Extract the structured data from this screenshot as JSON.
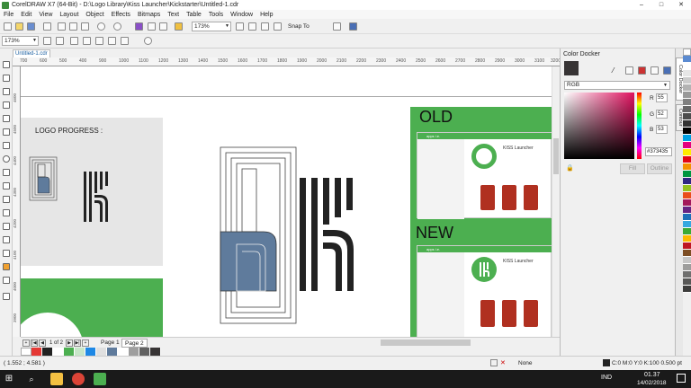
{
  "window": {
    "title": "CorelDRAW X7 (64-Bit) - D:\\Logo Library\\Kiss Launcher\\Kickstarter\\Untitled-1.cdr",
    "minimize": "–",
    "maximize": "□",
    "close": "✕"
  },
  "menu": [
    "File",
    "Edit",
    "View",
    "Layout",
    "Object",
    "Effects",
    "Bitmaps",
    "Text",
    "Table",
    "Tools",
    "Window",
    "Help"
  ],
  "toolbar": {
    "zoom": "173%",
    "snap_to": "Snap To",
    "zoom_left": "173%"
  },
  "document": {
    "tab": "Untitled-1.cdr"
  },
  "ruler": {
    "h_ticks": [
      "700",
      "600",
      "500",
      "400",
      "900",
      "1000",
      "1100",
      "1200",
      "1300",
      "1400",
      "1500",
      "1600",
      "1700",
      "1800",
      "1900",
      "2000",
      "2100",
      "2200",
      "2300",
      "2400",
      "2500",
      "2600",
      "2700",
      "2800",
      "2900",
      "3000",
      "3100",
      "3200"
    ],
    "v_ticks": [
      "4600",
      "4500",
      "4400",
      "4300",
      "4200",
      "4100",
      "4000",
      "3900"
    ]
  },
  "canvas": {
    "logo_progress": "LOGO PROGRESS :",
    "old_label": "OLD",
    "new_label": "NEW",
    "app_name": "KISS Launcher",
    "appbar_label": "apps i.e.",
    "colors": {
      "green": "#4caf50",
      "slate": "#5f7b9c",
      "gray_panel": "#e6e6e6",
      "dark": "#222222"
    }
  },
  "page_nav": {
    "counter": "1 of 2",
    "page1": "Page 1",
    "page2": "Page 2"
  },
  "color_docker": {
    "title": "Color Docker",
    "model": "RGB",
    "r_label": "R",
    "g_label": "G",
    "b_label": "B",
    "r": "55",
    "g": "52",
    "b": "53",
    "hex": "#373435",
    "fill_btn": "Fill",
    "outline_btn": "Outline",
    "tab_color": "Color Docker",
    "tab_contour": "Contour"
  },
  "status": {
    "coords": "( 1.552 ; 4.581 )",
    "fill_none": "None",
    "outline_info": "C:0 M:0 Y:0 K:100  0.500 pt"
  },
  "taskbar": {
    "lang": "IND",
    "time": "01.37",
    "date": "14/02/2018"
  }
}
